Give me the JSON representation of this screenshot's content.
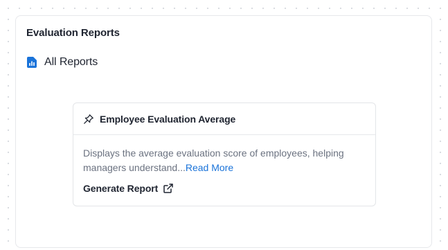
{
  "panel": {
    "title": "Evaluation Reports"
  },
  "nav": {
    "all_reports_label": "All Reports",
    "all_reports_icon": "report-chart-icon"
  },
  "report_card": {
    "pin_icon": "pin-icon",
    "title": "Employee Evaluation Average",
    "description": "Displays the average evaluation score of employees, helping managers understand...",
    "read_more_label": "Read More",
    "action_label": "Generate Report",
    "action_icon": "external-link-icon"
  },
  "colors": {
    "accent": "#1a73d9",
    "text_primary": "#1f2430",
    "text_muted": "#6b7280",
    "border": "#e6e8eb"
  }
}
